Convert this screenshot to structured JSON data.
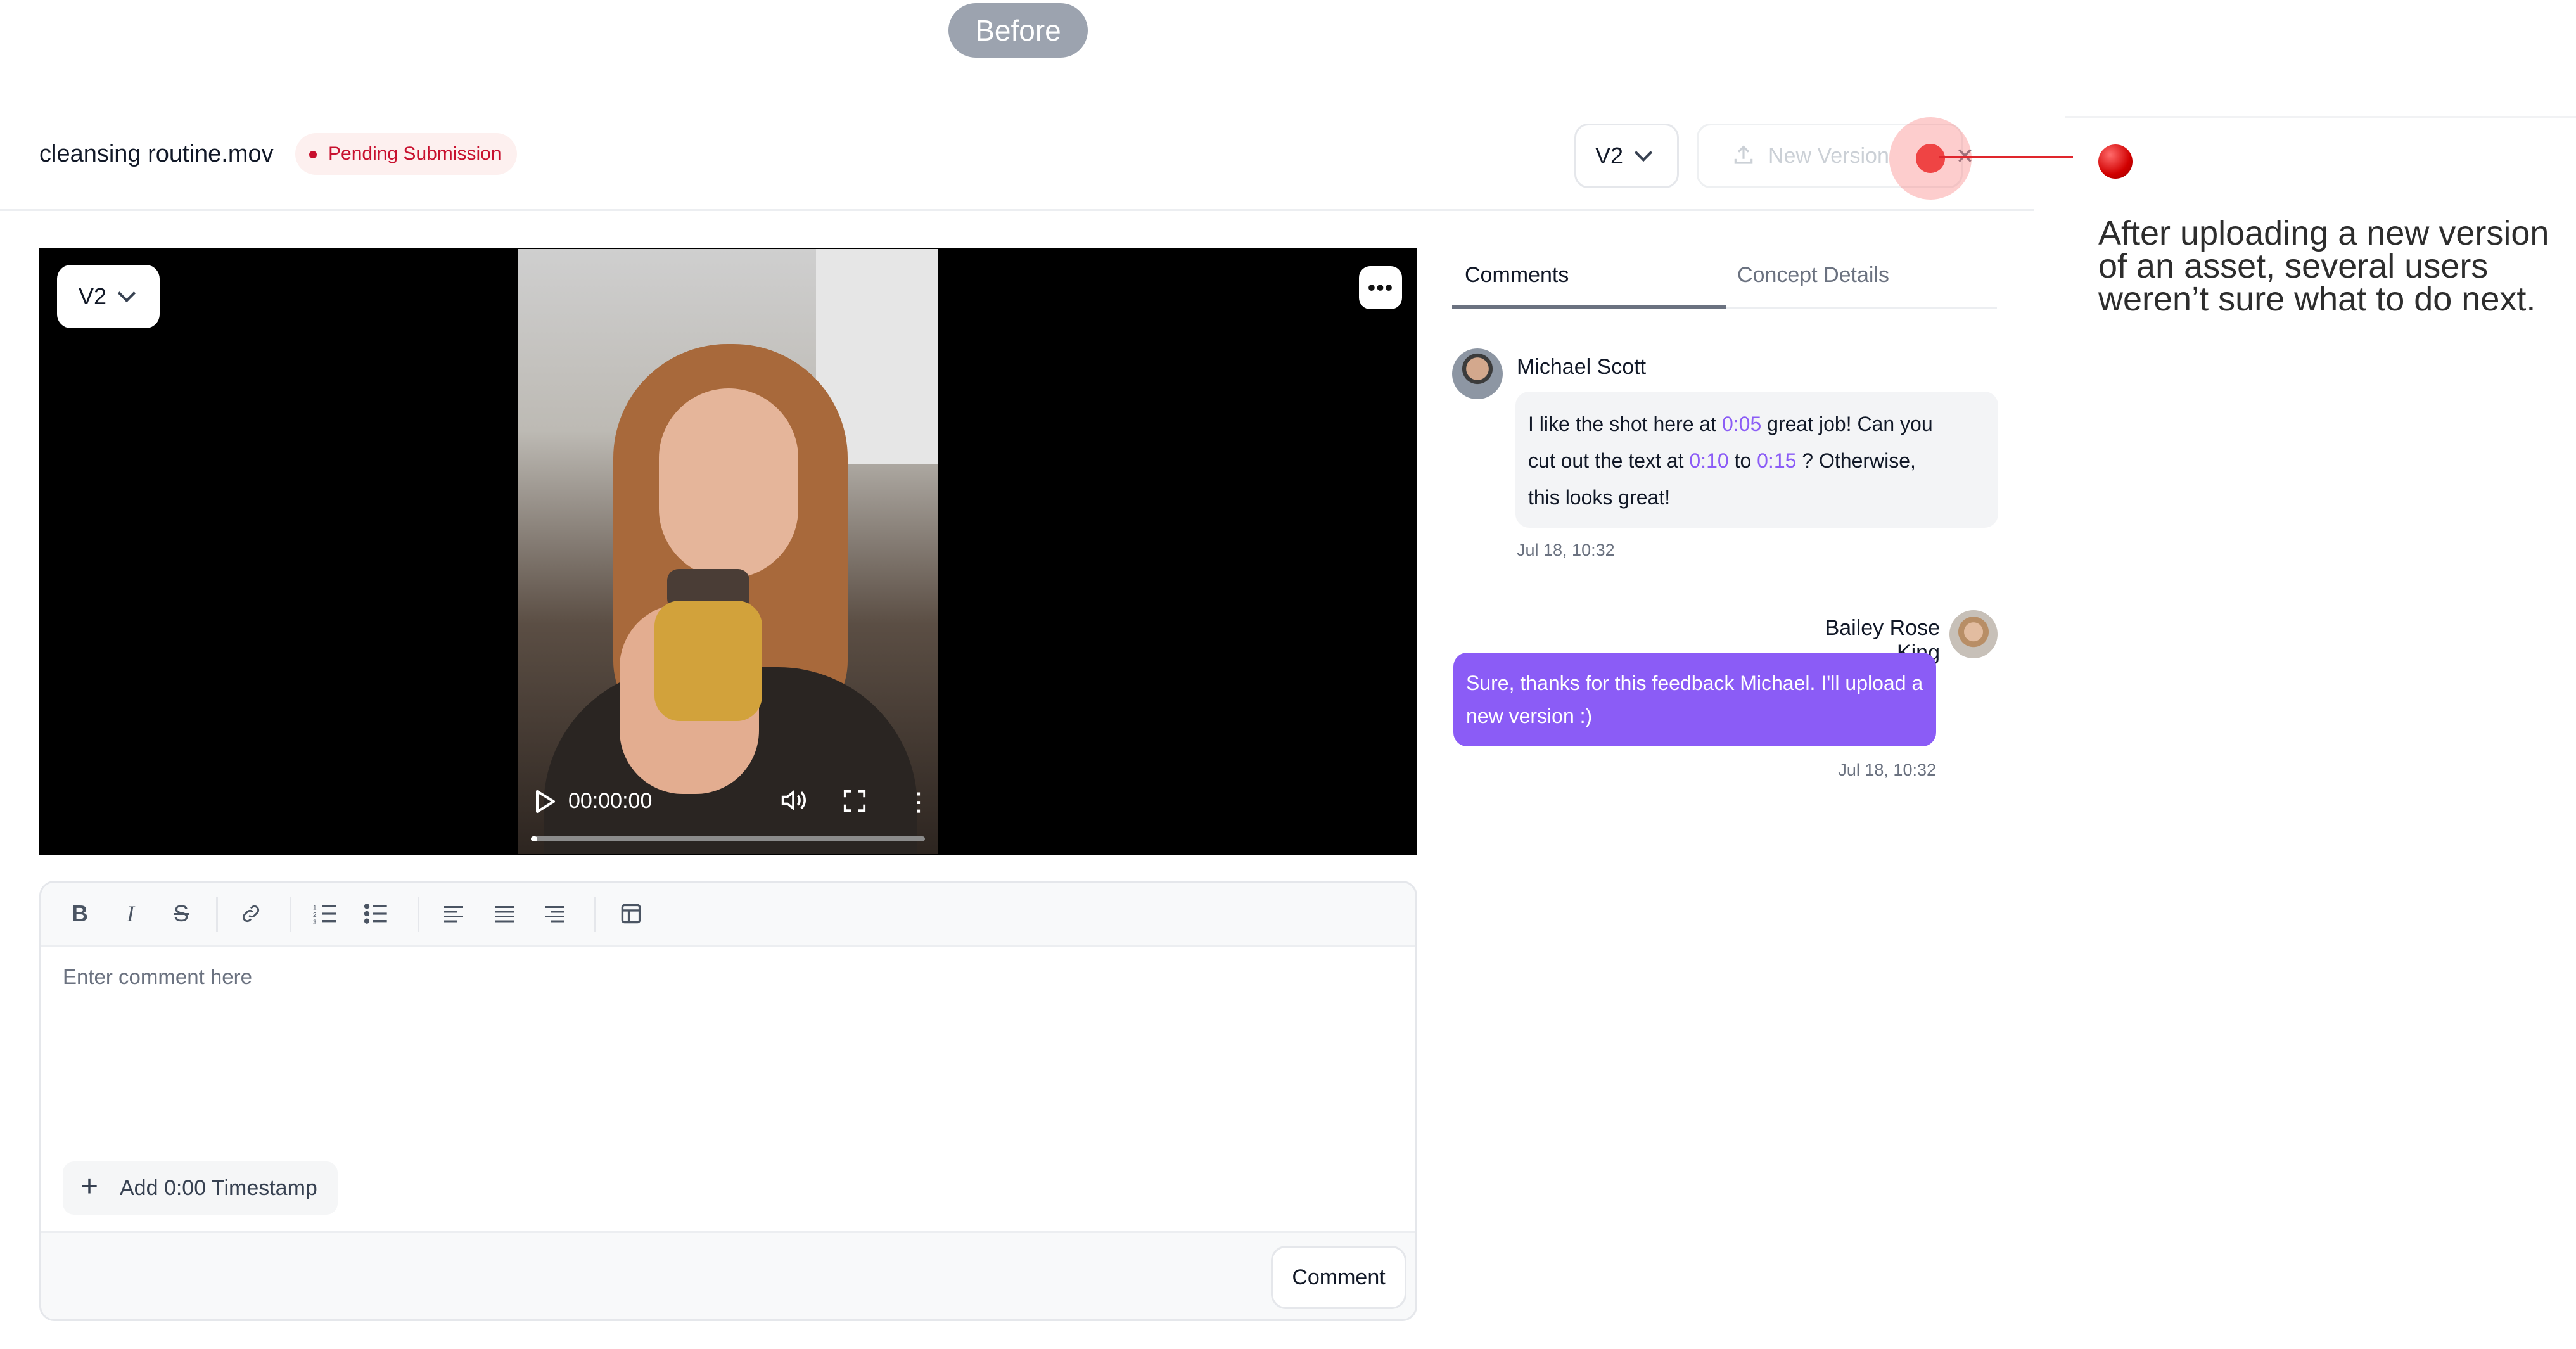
{
  "annotation": {
    "before_label": "Before",
    "note": "After uploading a new version of an asset, several users weren’t sure what to do next."
  },
  "header": {
    "file_name": "cleansing routine.mov",
    "status": "Pending Submission",
    "version_select": "V2",
    "new_version_label": "New Version",
    "close_glyph": "×"
  },
  "video": {
    "version_select": "V2",
    "more_glyph": "•••",
    "time": "00:00:00",
    "progress": 0.0
  },
  "editor": {
    "toolbar_icons": [
      "bold-icon",
      "italic-icon",
      "strikethrough-icon",
      "link-icon",
      "ordered-list-icon",
      "bullet-list-icon",
      "align-left-icon",
      "align-center-icon",
      "align-right-icon",
      "table-icon"
    ],
    "placeholder": "Enter comment here",
    "add_timestamp_label": "Add 0:00 Timestamp",
    "submit_label": "Comment"
  },
  "panel": {
    "tabs": [
      {
        "label": "Comments",
        "active": true
      },
      {
        "label": "Concept Details",
        "active": false
      }
    ],
    "comments": [
      {
        "author": "Michael Scott",
        "parts": [
          "I like the shot here at",
          "0:05",
          "great job! Can you",
          "cut out the text at",
          "0:10",
          "to",
          "0:15",
          "? Otherwise,",
          "this looks great!"
        ],
        "date": "Jul 18, 10:32"
      },
      {
        "author": "Bailey Rose King",
        "text": "Sure, thanks for this feedback Michael. I'll upload a new version :)",
        "date": "Jul 18, 10:32"
      }
    ]
  },
  "colors": {
    "accent_purple": "#8b5cf6",
    "status_red": "#c8102e",
    "hotspot_red": "#ef4444"
  }
}
